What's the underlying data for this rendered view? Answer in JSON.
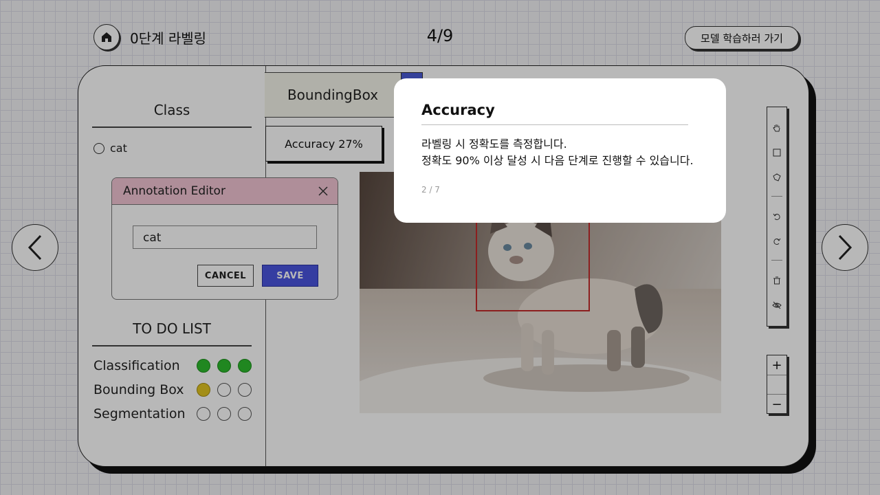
{
  "header": {
    "stage_title": "0단계 라벨링",
    "page_counter": "4/9",
    "train_button": "모델 학습하러 가기"
  },
  "left_panel": {
    "class_title": "Class",
    "classes": [
      {
        "label": "cat",
        "selected": false
      }
    ],
    "todo_title": "TO DO LIST",
    "todo": [
      {
        "label": "Classification",
        "progress": 3,
        "total": 3,
        "color": "#2dbb2d"
      },
      {
        "label": "Bounding Box",
        "progress": 1,
        "total": 3,
        "color": "#e2c521"
      },
      {
        "label": "Segmentation",
        "progress": 0,
        "total": 3,
        "color": ""
      }
    ]
  },
  "workspace": {
    "tab_label": "BoundingBox",
    "accuracy_label": "Accuracy 27%",
    "image_subject": "cat"
  },
  "editor": {
    "title": "Annotation Editor",
    "input_value": "cat",
    "cancel_label": "CANCEL",
    "save_label": "SAVE"
  },
  "toolbar": {
    "tools": [
      "hand-icon",
      "rectangle-icon",
      "polygon-icon",
      "undo-icon",
      "redo-icon",
      "trash-icon",
      "eye-off-icon"
    ],
    "zoom_in": "+",
    "zoom_out": "−"
  },
  "modal": {
    "title": "Accuracy",
    "line1": "라벨링 시 정확도를 측정합니다.",
    "line2": "정확도 90% 이상 달성 시 다음 단계로 진행할 수 있습니다.",
    "step": "2 / 7"
  },
  "colors": {
    "accent_blue": "#4a55e0",
    "editor_header": "#f3c5d5",
    "bbox_red": "#c22a2a"
  }
}
